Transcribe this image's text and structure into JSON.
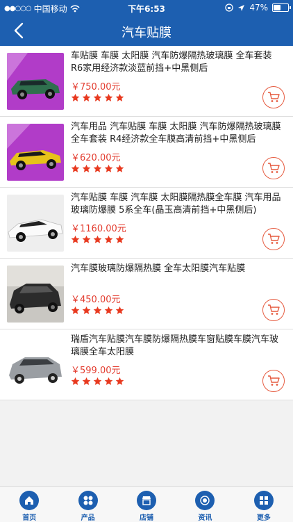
{
  "status": {
    "signal_dots": "●●○○○",
    "carrier": "中国移动",
    "time": "下午6:53",
    "battery": "47%",
    "battery_level": 0.47
  },
  "header": {
    "title": "汽车贴膜"
  },
  "products": [
    {
      "name": "车贴膜 车膜 太阳膜 汽车防爆隔热玻璃膜 全车套装 R6家用经济款淡蓝前挡+中黑侧后",
      "price": "￥750.00元",
      "rating": 5
    },
    {
      "name": "汽车用品 汽车贴膜 车膜 太阳膜 汽车防爆隔热玻璃膜 全车套装 R4经济款全车膜高清前挡+中黑侧后",
      "price": "￥620.00元",
      "rating": 5
    },
    {
      "name": "汽车贴膜 车膜 汽车膜 太阳膜隔热膜全车膜 汽车用品玻璃防爆膜 5系全车(晶玉高清前挡+中黑侧后)",
      "price": "￥1160.00元",
      "rating": 5
    },
    {
      "name": "汽车膜玻璃防爆隔热膜 全车太阳膜汽车贴膜",
      "price": "￥450.00元",
      "rating": 5
    },
    {
      "name": "瑞盾汽车贴膜汽车膜防爆隔热膜车窗贴膜车膜汽车玻璃膜全车太阳膜",
      "price": "￥599.00元",
      "rating": 5
    }
  ],
  "tabbar": [
    {
      "label": "首页",
      "icon": "home-icon"
    },
    {
      "label": "产品",
      "icon": "grid-circles-icon"
    },
    {
      "label": "店铺",
      "icon": "shop-icon"
    },
    {
      "label": "资讯",
      "icon": "news-icon"
    },
    {
      "label": "更多",
      "icon": "more-icon"
    }
  ],
  "colors": {
    "brand": "#1d5fb0",
    "price": "#e33b2e",
    "star": "#e8391f"
  }
}
